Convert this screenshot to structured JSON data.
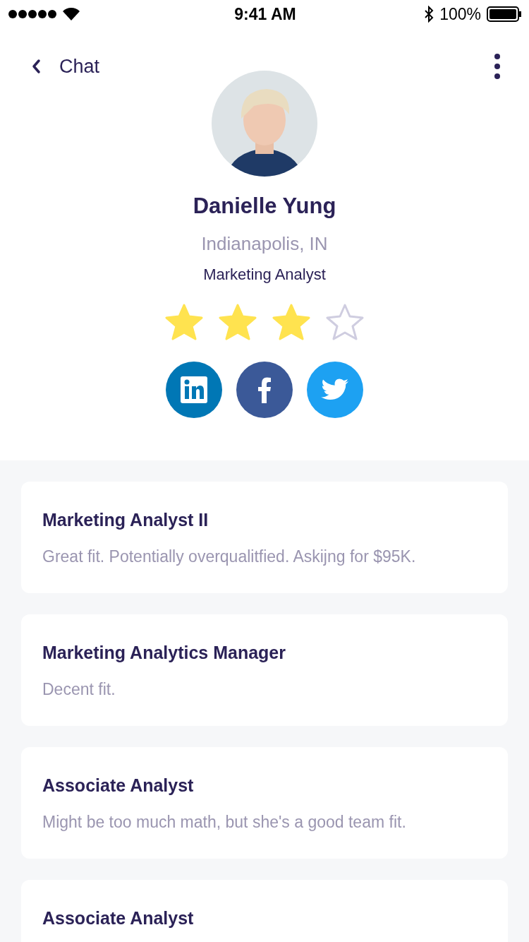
{
  "status_bar": {
    "time": "9:41 AM",
    "battery": "100%"
  },
  "nav": {
    "back_label": "Chat"
  },
  "profile": {
    "kind": "picture",
    "name": "Danielle Yung",
    "location": "Indianapolis, IN",
    "title": "Marketing Analyst",
    "stars": 3
  },
  "social": [
    {
      "kind": "linkedin",
      "color": "#0077b5"
    },
    {
      "kind": "facebook",
      "color": "#3b5998"
    },
    {
      "kind": "twitter",
      "color": "#1da1f2"
    }
  ],
  "cards": [
    {
      "title": "Marketing Analyst II",
      "note": "Great fit. Potentially overqualitfied. Askijng for $95K."
    },
    {
      "title": "Marketing Analytics Manager",
      "note": "Decent fit."
    },
    {
      "title": "Associate Analyst",
      "note": "Might be too much math, but she's a good team fit."
    },
    {
      "title": "Associate Analyst"
    }
  ]
}
